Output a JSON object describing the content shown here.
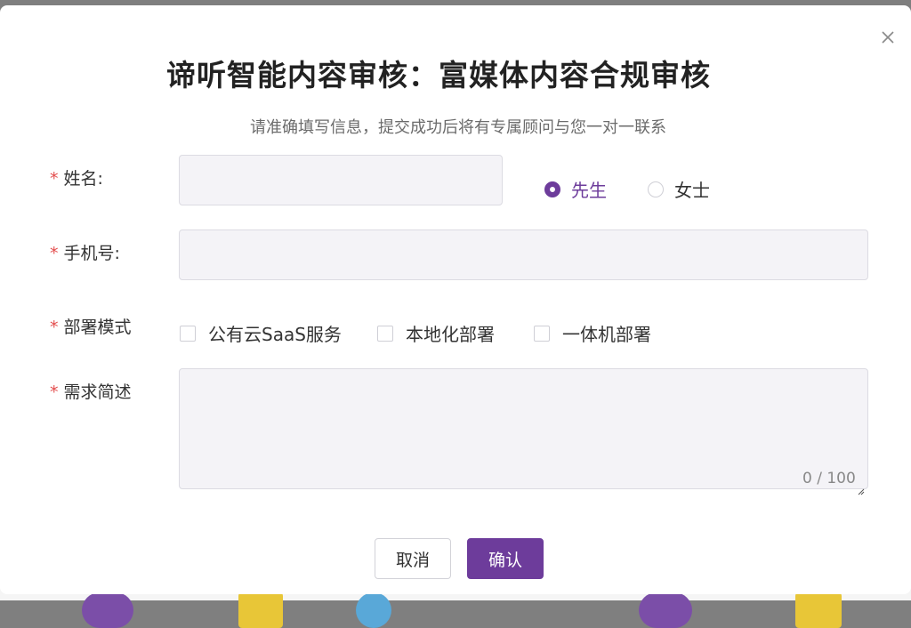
{
  "dialog": {
    "title": "谛听智能内容审核：富媒体内容合规审核",
    "subtitle": "请准确填写信息，提交成功后将有专属顾问与您一对一联系",
    "close_icon": "close-icon"
  },
  "form": {
    "required_mark": "*",
    "name": {
      "label": "姓名:",
      "value": ""
    },
    "gender": {
      "options": [
        {
          "label": "先生",
          "selected": true
        },
        {
          "label": "女士",
          "selected": false
        }
      ]
    },
    "phone": {
      "label": "手机号:",
      "value": ""
    },
    "deployment": {
      "label": "部署模式",
      "options": [
        {
          "label": "公有云SaaS服务",
          "checked": false
        },
        {
          "label": "本地化部署",
          "checked": false
        },
        {
          "label": "一体机部署",
          "checked": false
        }
      ]
    },
    "description": {
      "label": "需求简述",
      "value": "",
      "counter": "0 / 100"
    }
  },
  "buttons": {
    "cancel": "取消",
    "confirm": "确认"
  },
  "colors": {
    "accent": "#6d3c9b",
    "required": "#e34d4d",
    "field_bg": "#f4f3f7"
  }
}
